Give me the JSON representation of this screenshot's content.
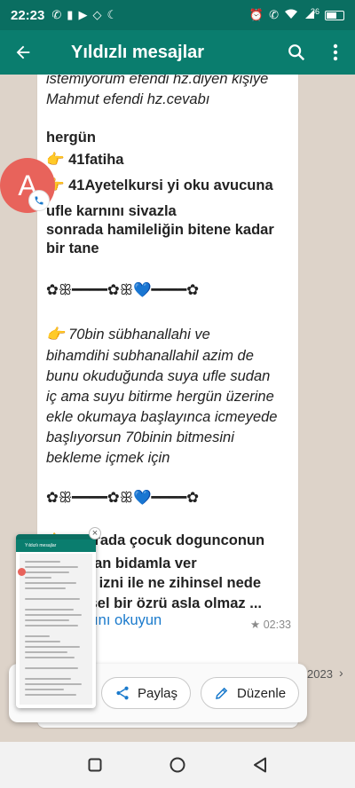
{
  "status_bar": {
    "time": "22:23",
    "left_icons": [
      "phone-icon",
      "sim-alert-icon",
      "youtube-icon",
      "signal-gap-icon",
      "moon-icon"
    ],
    "signal_label": "36",
    "battery_level": 0.55,
    "right_icons": [
      "alarm-icon",
      "wifi-call-icon",
      "wifi-icon",
      "signal-icon",
      "battery-icon"
    ]
  },
  "app_bar": {
    "title": "Yıldızlı mesajlar",
    "back_icon": "arrow-left-icon",
    "search_icon": "search-icon",
    "more_icon": "more-vertical-icon",
    "color": "#0a7d6e"
  },
  "message": {
    "lines": [
      "istemiyorum efendi hz.diyen kişiye",
      "Mahmut efendi hz.cevabı",
      "hergün",
      "👉 41fatiha",
      "👉 41Ayetelkursi yi oku avucuna",
      "ufle karnını sivazla",
      "sonrada hamileliğin bitene kadar",
      "bir tane",
      "✿ꕥ━━━━✿ꕥ💙━━━━✿",
      "👉 70bin sübhanallahi ve",
      "bihamdihi subhanallahil azim de",
      "bunu okuduğunda suya ufle sudan",
      "iç ama suyu bitirme hergün üzerine",
      "ekle okumaya başlayınca icmeyede",
      "başlıyorsun 70binin bitmesini",
      "bekleme içmek için",
      "✿ꕥ━━━━✿ꕥ💙━━━━✿",
      "👉 sonrada çocuk dogunconun",
      "bu sudan bidamla ver",
      "Allahın izni ile ne zihinsel nede",
      "bedensel bir özrü asla olmaz ...",
      "Tamamını okuyun"
    ],
    "time": "02:33",
    "starred": true
  },
  "date_label": "2023",
  "sender_avatar": {
    "letter": "A",
    "color": "#e8635b"
  },
  "share_sheet": {
    "share_label": "Paylaş",
    "edit_label": "Düzenle",
    "share_icon": "share-icon",
    "edit_icon": "pencil-icon",
    "preview_title": "Yıldızlı mesajlar"
  },
  "emoji_row": "👶🏽👶🏽📚👶🏽👶🏽📚👶🏽👶🏽📚👶🏽",
  "nav_bar": {
    "icons": [
      "recents-square-icon",
      "home-circle-icon",
      "back-triangle-icon"
    ]
  }
}
